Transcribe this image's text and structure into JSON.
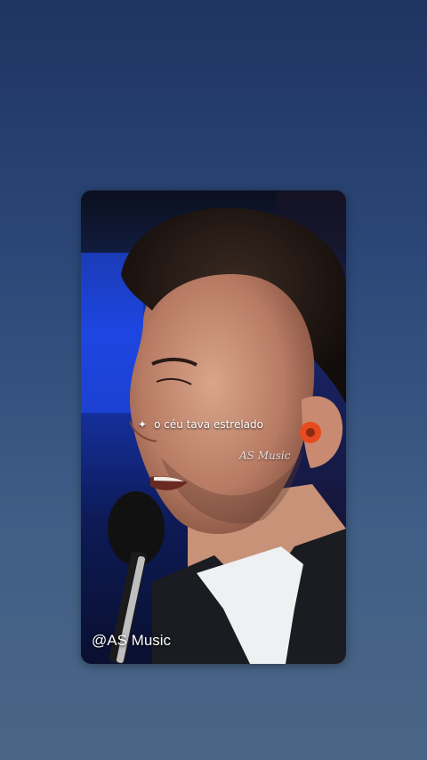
{
  "video": {
    "caption": "o céu tava estrelado",
    "caption_icon": "sparkle-icon",
    "watermark_center": "AS Music",
    "watermark_bottom": "@AS Music"
  },
  "colors": {
    "background_top": "#1f3461",
    "background_bottom": "#4a6585",
    "stage_blue": "#1a3fd0",
    "earpiece": "#e84a1f"
  }
}
